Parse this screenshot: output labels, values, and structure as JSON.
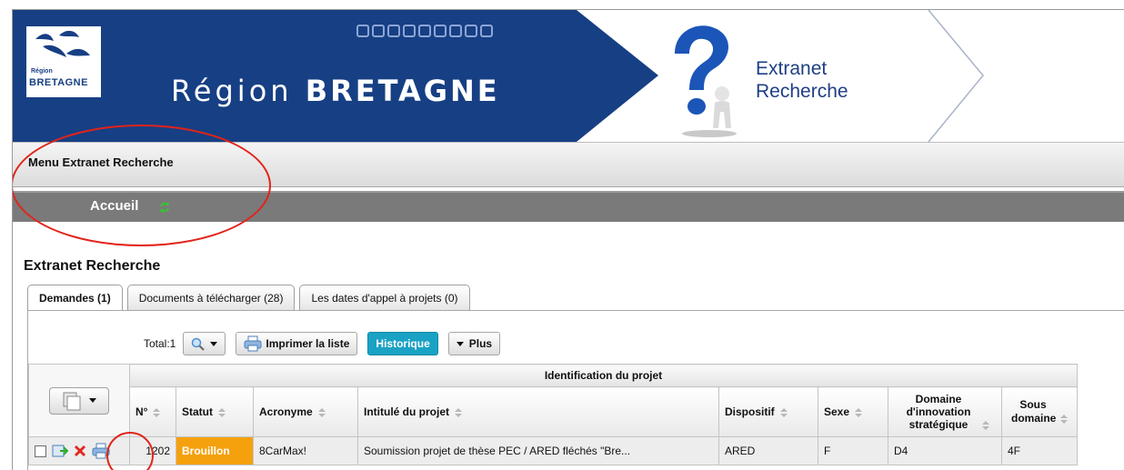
{
  "banner": {
    "region_small": "Région",
    "region_logo": "BRETAGNE",
    "region_prefix": "Région",
    "region_name": "BRETAGNE",
    "extranet_line1": "Extranet",
    "extranet_line2": "Recherche",
    "colors": {
      "brand_blue": "#173f84",
      "light_blue": "#8da6d6"
    }
  },
  "menu": {
    "title": "Menu Extranet Recherche",
    "home": "Accueil"
  },
  "page": {
    "title": "Extranet Recherche"
  },
  "tabs": [
    {
      "label": "Demandes (1)",
      "active": true
    },
    {
      "label": "Documents à télécharger (28)",
      "active": false
    },
    {
      "label": "Les dates d'appel à projets (0)",
      "active": false
    }
  ],
  "toolbar": {
    "total": "Total:1",
    "search_icon": "search-icon",
    "print_label": "Imprimer la liste",
    "history_label": "Historique",
    "more_label": "Plus",
    "colors": {
      "history_bg": "#1aa2c4"
    }
  },
  "table": {
    "group_header": "Identification du projet",
    "columns": [
      {
        "key": "numero",
        "label": "N°"
      },
      {
        "key": "statut",
        "label": "Statut"
      },
      {
        "key": "acronyme",
        "label": "Acronyme"
      },
      {
        "key": "intitule",
        "label": "Intitulé du projet"
      },
      {
        "key": "dispositif",
        "label": "Dispositif"
      },
      {
        "key": "sexe",
        "label": "Sexe"
      },
      {
        "key": "domaine",
        "label": "Domaine d'innovation stratégique"
      },
      {
        "key": "sous_domaine",
        "label": "Sous domaine"
      }
    ],
    "rows": [
      {
        "numero": "1202",
        "statut": "Brouillon",
        "acronyme": "8CarMax!",
        "intitule": "Soumission projet de thèse PEC / ARED fléchés \"Bre...",
        "dispositif": "ARED",
        "sexe": "F",
        "domaine": "D4",
        "sous_domaine": "4F"
      }
    ],
    "colors": {
      "status_draft": "#f5a10e"
    }
  },
  "annotations": {
    "highlight_color": "#e2231a"
  }
}
